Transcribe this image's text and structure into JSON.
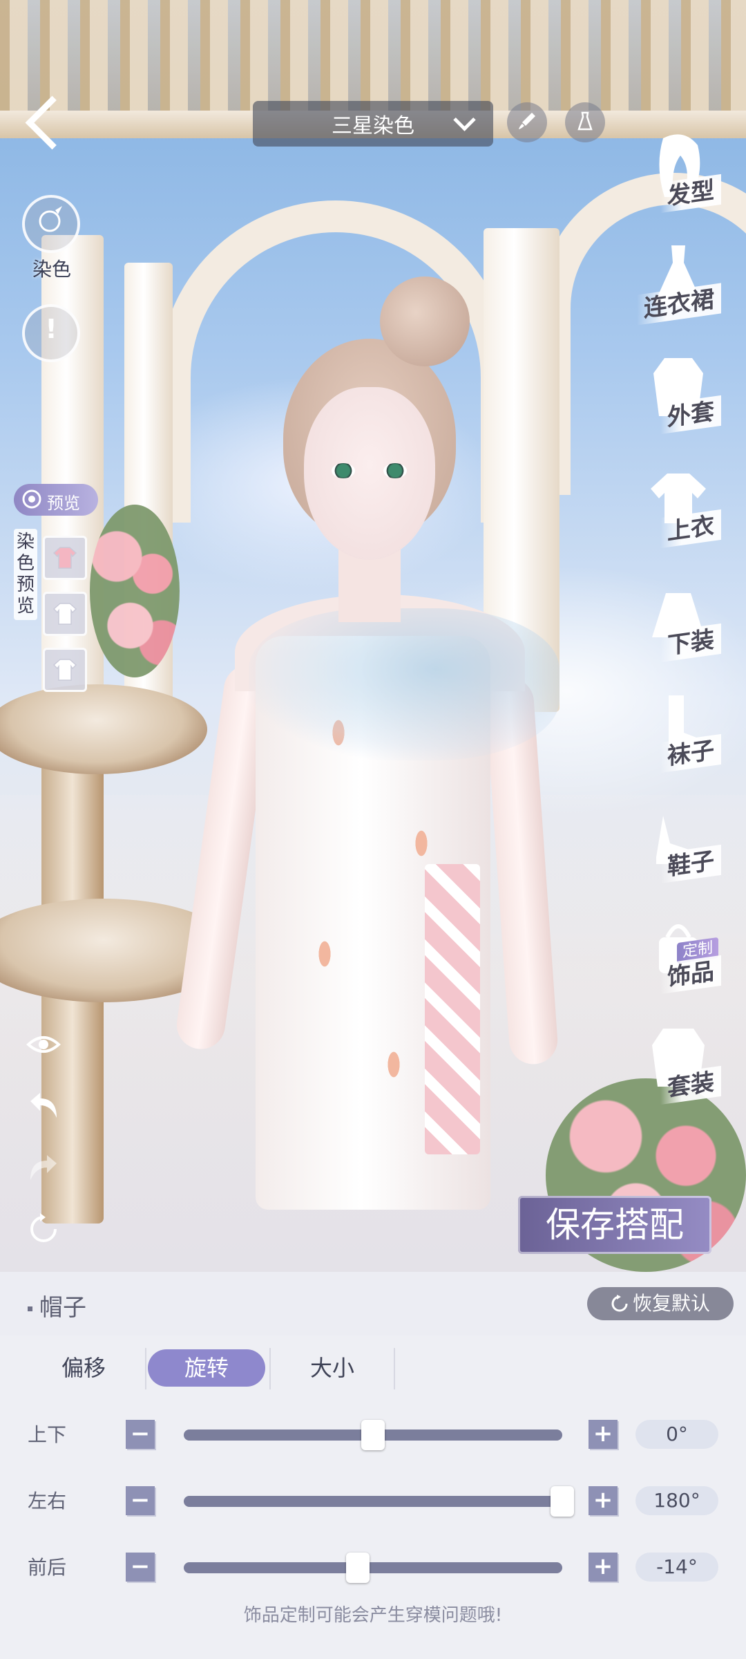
{
  "title_select": {
    "label": "三星染色"
  },
  "left_tools": {
    "dye_label": "染色"
  },
  "preview": {
    "pill_label": "预览",
    "vertical_label": "染色预览",
    "swatch_colors": [
      "#f4b6c2",
      "#ffffff",
      "#ffffff"
    ]
  },
  "categories": [
    {
      "label": "发型",
      "icon": "hair-icon"
    },
    {
      "label": "连衣裙",
      "icon": "dress-icon"
    },
    {
      "label": "外套",
      "icon": "coat-icon"
    },
    {
      "label": "上衣",
      "icon": "top-icon"
    },
    {
      "label": "下装",
      "icon": "skirt-icon"
    },
    {
      "label": "袜子",
      "icon": "socks-icon"
    },
    {
      "label": "鞋子",
      "icon": "shoe-icon"
    },
    {
      "label": "饰品",
      "icon": "accessory-icon",
      "badge": "定制"
    },
    {
      "label": "套装",
      "icon": "suit-icon"
    }
  ],
  "save_button": {
    "label": "保存搭配"
  },
  "panel": {
    "title": "帽子",
    "reset_label": "恢复默认",
    "tabs": [
      {
        "label": "偏移",
        "active": false
      },
      {
        "label": "旋转",
        "active": true
      },
      {
        "label": "大小",
        "active": false
      }
    ],
    "sliders": [
      {
        "label": "上下",
        "value": "0°",
        "fraction": 0.5
      },
      {
        "label": "左右",
        "value": "180°",
        "fraction": 1.0
      },
      {
        "label": "前后",
        "value": "-14°",
        "fraction": 0.46
      }
    ],
    "minus": "−",
    "plus": "+",
    "footer_note": "饰品定制可能会产生穿模问题哦!"
  },
  "colors": {
    "accent": "#8e88cd",
    "track": "#7b7e9c"
  }
}
